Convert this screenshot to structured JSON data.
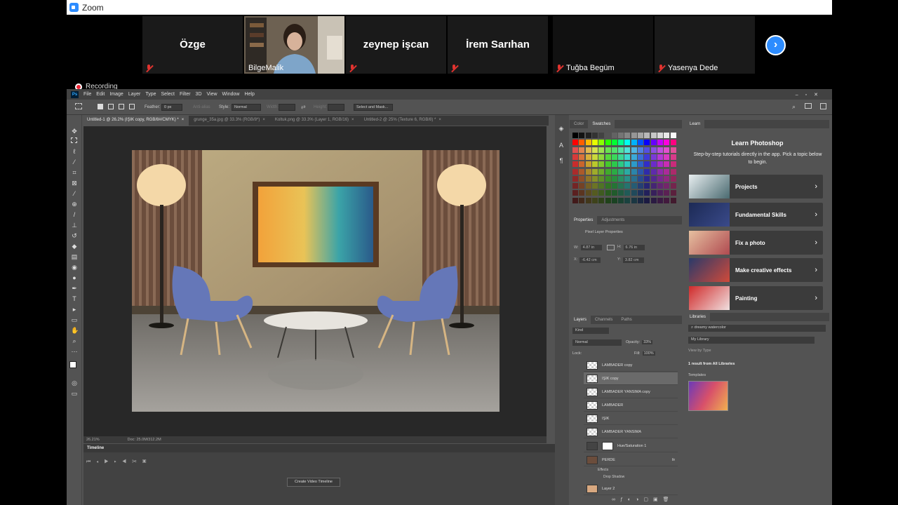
{
  "zoom": {
    "title": "Zoom",
    "participants": [
      {
        "name": "Özge",
        "muted": true
      },
      {
        "name": "BilgeMalik",
        "muted": false,
        "video": true
      },
      {
        "name": "zeynep işcan",
        "muted": true
      },
      {
        "name": "İrem Sarıhan",
        "muted": true
      },
      {
        "name": "Tuğba Begüm",
        "muted": true
      },
      {
        "name": "Yasenya Dede",
        "muted": true
      }
    ],
    "recording": "Recording",
    "next_icon": "chevron-right-icon"
  },
  "ps": {
    "menu": [
      "File",
      "Edit",
      "Image",
      "Layer",
      "Type",
      "Select",
      "Filter",
      "3D",
      "View",
      "Window",
      "Help"
    ],
    "options": {
      "feather_label": "Feather:",
      "feather_value": "0 px",
      "antialias": "Anti-alias",
      "style_label": "Style:",
      "style_value": "Normal",
      "width_label": "Width:",
      "height_label": "Height:",
      "select_mask": "Select and Mask..."
    },
    "tabs": [
      "Untitled-1 @ 26.2% (IŞIK copy, RGB/8#/CMYK) *",
      "grunge_35a.jpg @ 33.3% (RGB/8*)",
      "Koltuk.png @ 33.3% (Layer 1, RGB/16)",
      "Untitled-2 @ 25% (Texture 6, RGB/8) *"
    ],
    "status": {
      "zoom": "26.21%",
      "doc": "Doc: 25.0M/312.2M"
    },
    "timeline": {
      "title": "Timeline",
      "create_button": "Create Video Timeline"
    },
    "swatches_panel": {
      "tabs": [
        "Color",
        "Swatches"
      ]
    },
    "properties": {
      "tabs": [
        "Properties",
        "Adjustments"
      ],
      "heading": "Pixel Layer Properties",
      "w_label": "W:",
      "w": "4.87 in",
      "h_label": "H:",
      "h": "6.76 in",
      "x_label": "X:",
      "x": "-6.42 cm",
      "y_label": "Y:",
      "y": "3.82 cm"
    },
    "layers_panel": {
      "tabs": [
        "Layers",
        "Channels",
        "Paths"
      ],
      "kind": "Kind",
      "blend": "Normal",
      "opacity_label": "Opacity:",
      "opacity": "33%",
      "lock_label": "Lock:",
      "fill_label": "Fill:",
      "fill": "100%",
      "layers": [
        {
          "name": "LAMBADER copy"
        },
        {
          "name": "IŞIK copy",
          "selected": true
        },
        {
          "name": "LAMBADER YANSIMA copy"
        },
        {
          "name": "LAMBADER"
        },
        {
          "name": "IŞIK"
        },
        {
          "name": "LAMBADER YANSIMA"
        },
        {
          "name": "Hue/Saturation 1"
        },
        {
          "name": "PERDE",
          "fx": "fx"
        },
        {
          "name": "Effects"
        },
        {
          "name": "Drop Shadow"
        },
        {
          "name": "Layer 2"
        }
      ]
    },
    "learn": {
      "tab": "Learn",
      "title": "Learn Photoshop",
      "subtitle": "Step-by-step tutorials directly in the app. Pick a topic below to begin.",
      "cards": [
        "Projects",
        "Fundamental Skills",
        "Fix a photo",
        "Make creative effects",
        "Painting"
      ]
    },
    "libraries": {
      "tab": "Libraries",
      "search": "dreamy watercolor",
      "library": "My Library",
      "view_by": "View by Type",
      "result": "1 result from All Libraries",
      "section": "Templates"
    }
  }
}
